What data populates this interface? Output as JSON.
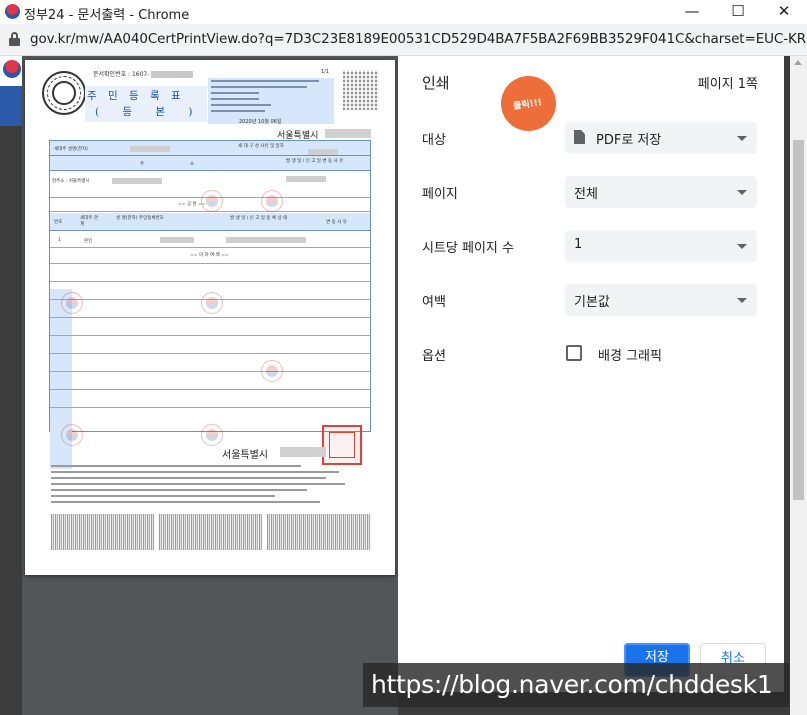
{
  "window": {
    "title": "정부24 - 문서출력 - Chrome",
    "minimize_glyph": "—",
    "maximize_glyph": "☐",
    "close_glyph": "✕"
  },
  "address_bar": {
    "url": "gov.kr/mw/AA040CertPrintView.do?q=7D3C23E8189E00531CD529D4BA7F5BA2F69BB3529F041C&charset=EUC-KR#"
  },
  "document": {
    "doc_number_label": "문서확인번호 : 1607-",
    "page_indicator": "1/1",
    "title_line1": "주 민 등 록 표",
    "title_line2": "( 등   본 )",
    "issue_date": "2020년 10월 06일",
    "city_top": "서울특별시",
    "city_bottom": "서울특별시",
    "header_row1": [
      "세대주 성명(한자)",
      "세 대 구 성 사유 및 일자"
    ],
    "header_row2": [
      "주",
      "소",
      "발 생 일 / 신 고 일 변 동 사 유"
    ],
    "address_prefix": "현주소 : 서울특별시",
    "former_address": "== 공 란 ==",
    "header_row3": [
      "번호",
      "세대주 관계",
      "성 명(한자) 주민등록번호",
      "발 생 일 / 신 고 일 등 록 상 태",
      "변 동 사 유"
    ],
    "row1": [
      "1",
      "본인"
    ],
    "end_marker": "== 이 하 여 백 =="
  },
  "print_settings": {
    "heading": "인쇄",
    "page_count": "페이지 1쪽",
    "callout": "클릭!!!",
    "destination": {
      "label": "대상",
      "value": "PDF로 저장"
    },
    "pages": {
      "label": "페이지",
      "value": "전체"
    },
    "pages_per_sheet": {
      "label": "시트당 페이지 수",
      "value": "1"
    },
    "margins": {
      "label": "여백",
      "value": "기본값"
    },
    "options": {
      "label": "옵션",
      "background_graphics_label": "배경 그래픽",
      "background_graphics_checked": false
    },
    "save_button": "저장",
    "cancel_button": "취소"
  },
  "overlay_watermark": "https://blog.naver.com/chddesk1",
  "colors": {
    "accent": "#1a73e8",
    "callout": "#ee6e3a",
    "doc_table_border": "#6b8fc9",
    "doc_header_fill": "#d6e7fb"
  }
}
